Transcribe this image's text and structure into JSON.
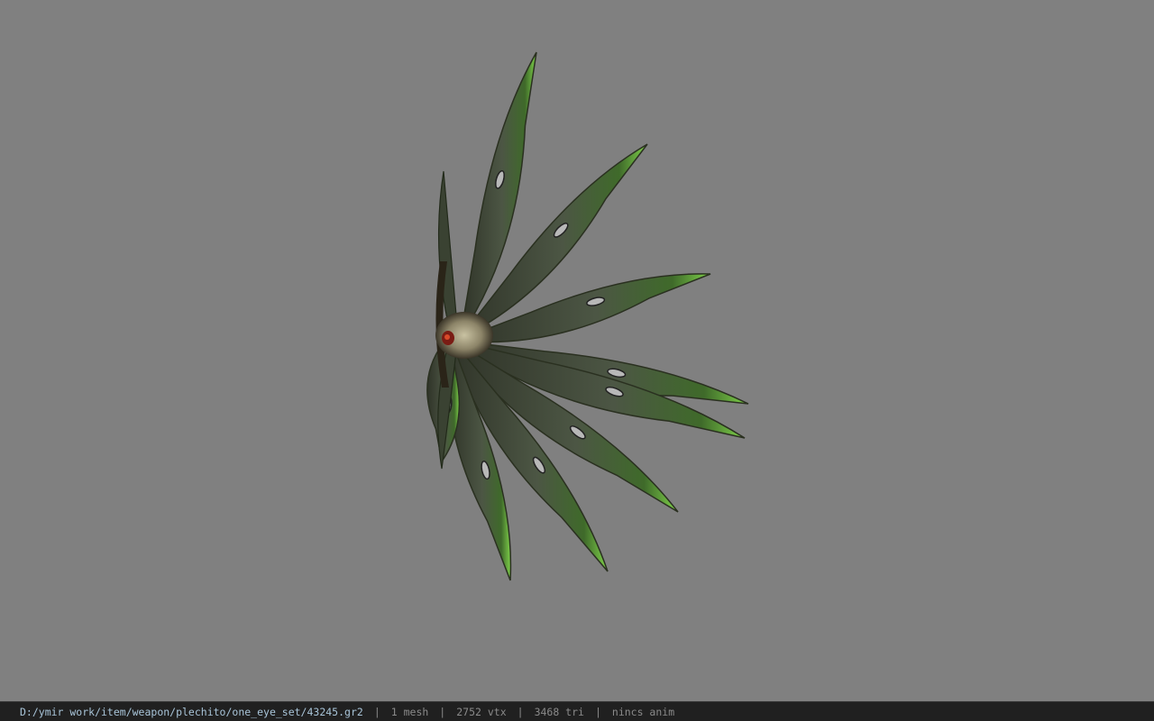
{
  "viewer": {
    "background_color": "#808080",
    "model_icon": "fan-blade-weapon-model"
  },
  "status_bar": {
    "file_path": "D:/ymir work/item/weapon/plechito/one_eye_set/43245.gr2",
    "mesh_count": "1 mesh",
    "vertex_count": "2752 vtx",
    "triangle_count": "3468 tri",
    "anim_status": "nincs anim",
    "separator": "|"
  }
}
